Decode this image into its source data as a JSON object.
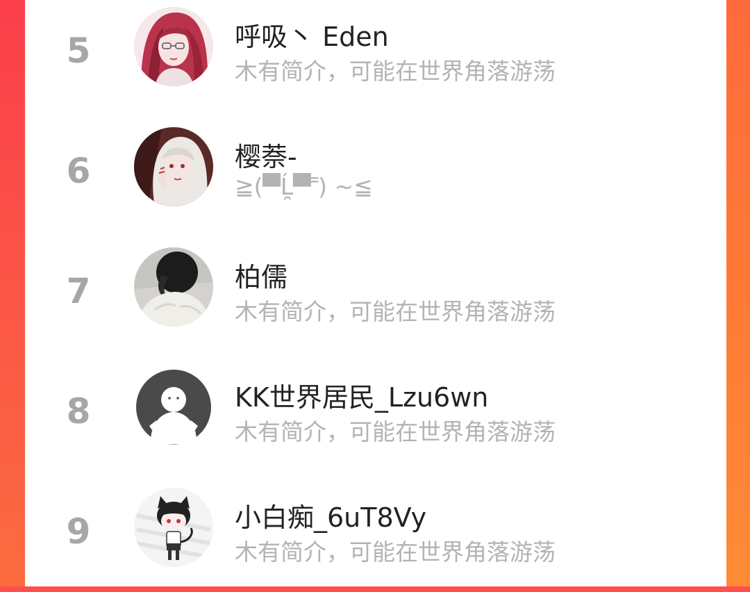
{
  "colors": {
    "accent_left": "#fb3f4b",
    "accent_right": "#ff7a36",
    "rank_text": "#a6a6a6",
    "name_text": "#222222",
    "bio_text": "#b3b3b3"
  },
  "ranking": {
    "items": [
      {
        "rank": "5",
        "name": "呼吸丶 Eden",
        "bio": "木有简介，可能在世界角落游荡",
        "avatar_icon": "anime-girl-red-hair-avatar"
      },
      {
        "rank": "6",
        "name": "樱萘-",
        "bio": "≧(▀̿Ĺ̯▀̿ ̿) ~≦",
        "avatar_icon": "anime-girl-white-hair-avatar"
      },
      {
        "rank": "7",
        "name": "柏儒",
        "bio": "木有简介，可能在世界角落游荡",
        "avatar_icon": "dark-hair-person-avatar"
      },
      {
        "rank": "8",
        "name": "KK世界居民_Lzu6wn",
        "bio": "木有简介，可能在世界角落游荡",
        "avatar_icon": "default-user-avatar"
      },
      {
        "rank": "9",
        "name": "小白痴_6uT8Vy",
        "bio": "木有简介，可能在世界角落游荡",
        "avatar_icon": "chibi-cat-boy-avatar"
      }
    ]
  }
}
